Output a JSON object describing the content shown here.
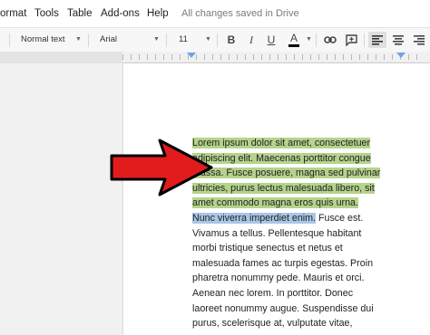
{
  "menu": {
    "items": [
      "ormat",
      "Tools",
      "Table",
      "Add-ons",
      "Help"
    ],
    "save_status": "All changes saved in Drive"
  },
  "toolbar": {
    "style_label": "Normal text",
    "font_label": "Arial",
    "size_label": "11",
    "bold_label": "B",
    "italic_label": "I",
    "underline_label": "U",
    "text_color_label": "A",
    "text_color": "#000000"
  },
  "document": {
    "highlighted_lines": [
      "Lorem ipsum dolor sit amet, consectetuer",
      "adipiscing elit. Maecenas porttitor congue",
      "massa. Fusce posuere, magna sed pulvinar",
      "ultricies, purus lectus malesuada libero, sit",
      "amet commodo magna eros quis urna."
    ],
    "partial_line_highlight": "Nunc viverra imperdiet enim.",
    "partial_line_rest": " Fusce est.",
    "plain_lines": [
      "Vivamus a tellus. Pellentesque habitant",
      "morbi tristique senectus et netus et",
      "malesuada fames ac turpis egestas. Proin",
      "pharetra nonummy pede. Mauris et orci.",
      "Aenean nec lorem. In porttitor. Donec",
      "laoreet nonummy augue. Suspendisse dui",
      "purus, scelerisque at, vulputate vitae,"
    ],
    "highlight_color": "#b5d38c",
    "selection_color": "#a9c7e6"
  },
  "annotation": {
    "arrow_color": "#e21c1c",
    "arrow_outline": "#000000"
  }
}
